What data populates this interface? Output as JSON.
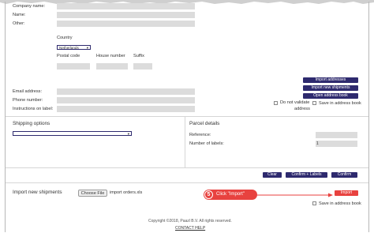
{
  "form": {
    "company_name_label": "Company name:",
    "name_label": "Name:",
    "other_label": "Other:",
    "country_label": "Country",
    "country_value": "Netherlands",
    "postal_code_label": "Postal code",
    "house_number_label": "House number",
    "suffix_label": "Suffix",
    "email_label": "Email address:",
    "phone_label": "Phone number:",
    "instructions_label": "Instructions on label:"
  },
  "address_buttons": {
    "import_addresses": "Import addresses",
    "import_new_shipments": "Import new shipments",
    "open_address_book": "Open address book"
  },
  "address_options": {
    "do_not_validate_line1": "Do not validate",
    "do_not_validate_line2": "address",
    "save_in_address_book": "Save in address book"
  },
  "shipping": {
    "title": "Shipping options",
    "select_value": ""
  },
  "parcel": {
    "title": "Parcel details",
    "reference_label": "Reference:",
    "labels_label": "Number of labels:",
    "labels_value": "1"
  },
  "actions": {
    "clear": "Clear",
    "confirm_labels": "Confirm + Labels",
    "confirm": "Confirm"
  },
  "import_section": {
    "title": "Import new shipments",
    "choose_file": "Choose File",
    "file_name": "import orders.xls",
    "import_button": "Import",
    "save_in_address_book": "Save in address book"
  },
  "callout": {
    "step": "5",
    "text": "Click \"Import\""
  },
  "footer": {
    "copyright": "Copyright ©2018, Paazl B.V. All rights reserved.",
    "contact_help": "CONTACT HELP"
  },
  "colors": {
    "primary_button": "#2e2a6e",
    "accent_red": "#e8423f",
    "field_gray": "#dcdcdc"
  }
}
